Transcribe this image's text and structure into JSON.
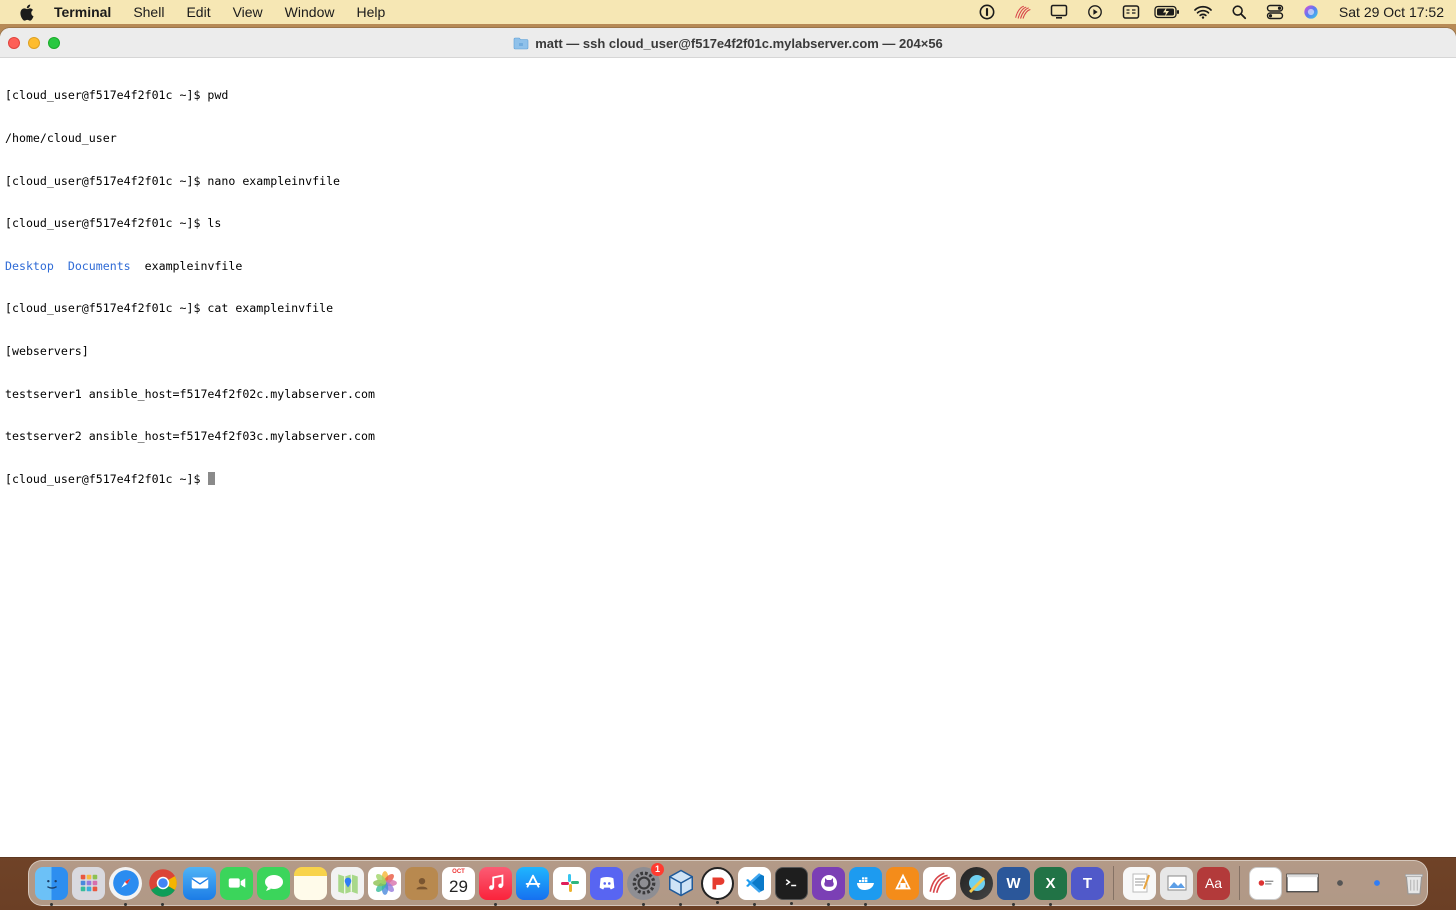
{
  "menubar": {
    "app_name": "Terminal",
    "menus": [
      "Shell",
      "Edit",
      "View",
      "Window",
      "Help"
    ],
    "clock": "Sat 29 Oct  17:52",
    "status_icons": [
      "1password-icon",
      "wave-app-icon",
      "display-icon",
      "play-icon",
      "keyboard-input-icon",
      "battery-charging-icon",
      "wifi-icon",
      "search-icon",
      "control-center-icon",
      "siri-icon"
    ]
  },
  "window": {
    "title": "matt — ssh cloud_user@f517e4f2f01c.mylabserver.com — 204×56"
  },
  "terminal": {
    "lines": [
      "[cloud_user@f517e4f2f01c ~]$ pwd",
      "/home/cloud_user",
      "[cloud_user@f517e4f2f01c ~]$ nano exampleinvfile",
      "[cloud_user@f517e4f2f01c ~]$ ls",
      "",
      "[cloud_user@f517e4f2f01c ~]$ cat exampleinvfile",
      "[webservers]",
      "testserver1 ansible_host=f517e4f2f02c.mylabserver.com",
      "testserver2 ansible_host=f517e4f2f03c.mylabserver.com"
    ],
    "ls_output": {
      "dir1": "Desktop",
      "dir2": "Documents",
      "file1": "exampleinvfile"
    },
    "prompt": "[cloud_user@f517e4f2f01c ~]$ "
  },
  "dock": {
    "calendar_month": "OCT",
    "calendar_day": "29",
    "settings_badge": "1",
    "dictionary_label": "Aa"
  },
  "colors": {
    "menubar_bg": "#f6e7b4",
    "directory_text": "#2f6bd6",
    "close": "#fe5f57",
    "minimize": "#febc2e",
    "maximize": "#28c840"
  }
}
